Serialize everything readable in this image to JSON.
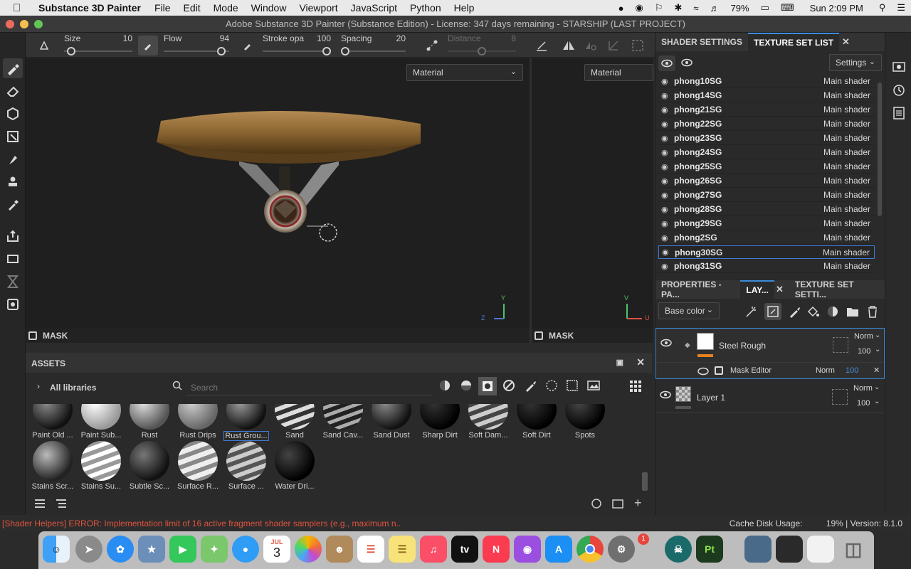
{
  "menubar": {
    "app": "Substance 3D Painter",
    "items": [
      "File",
      "Edit",
      "Mode",
      "Window",
      "Viewport",
      "JavaScript",
      "Python",
      "Help"
    ],
    "battery": "79%",
    "clock": "Sun 2:09 PM"
  },
  "window": {
    "title": "Adobe Substance 3D Painter (Substance Edition) - License: 347 days remaining - STARSHIP (LAST PROJECT)"
  },
  "tool_options": {
    "size_label": "Size",
    "size_value": "10",
    "size_fraction": 0.05,
    "flow_label": "Flow",
    "flow_value": "94",
    "flow_fraction": 0.94,
    "stroke_label": "Stroke opa",
    "stroke_value": "100",
    "stroke_fraction": 1.0,
    "spacing_label": "Spacing",
    "spacing_value": "20",
    "spacing_fraction": 0.0,
    "distance_label": "Distance",
    "distance_value": "8",
    "distance_fraction": 0.5
  },
  "viewport": {
    "channel_3d": "Material",
    "channel_2d": "Material",
    "mask_label": "MASK",
    "axis_y": "Y",
    "axis_z": "Z",
    "axis_u": "U",
    "axis_v": "V"
  },
  "assets": {
    "title": "ASSETS",
    "library": "All libraries",
    "search_placeholder": "Search",
    "row1": [
      "Paint Old ...",
      "Paint Sub...",
      "Rust",
      "Rust Drips",
      "Rust Grou...",
      "Sand",
      "Sand Cav...",
      "Sand Dust",
      "Sharp Dirt",
      "Soft Dam...",
      "Soft Dirt",
      "Spots"
    ],
    "row2": [
      "Stains Scr...",
      "Stains Su...",
      "Subtle Sc...",
      "Surface R...",
      "Surface ...",
      "Water Dri..."
    ],
    "selected": "Rust Grou..."
  },
  "texture_set": {
    "tab_shader": "SHADER SETTINGS",
    "tab_list": "TEXTURE SET LIST",
    "settings_label": "Settings",
    "rows": [
      {
        "name": "phong10SG",
        "shader": "Main shader"
      },
      {
        "name": "phong14SG",
        "shader": "Main shader"
      },
      {
        "name": "phong21SG",
        "shader": "Main shader"
      },
      {
        "name": "phong22SG",
        "shader": "Main shader"
      },
      {
        "name": "phong23SG",
        "shader": "Main shader"
      },
      {
        "name": "phong24SG",
        "shader": "Main shader"
      },
      {
        "name": "phong25SG",
        "shader": "Main shader"
      },
      {
        "name": "phong26SG",
        "shader": "Main shader"
      },
      {
        "name": "phong27SG",
        "shader": "Main shader"
      },
      {
        "name": "phong28SG",
        "shader": "Main shader"
      },
      {
        "name": "phong29SG",
        "shader": "Main shader"
      },
      {
        "name": "phong2SG",
        "shader": "Main shader"
      },
      {
        "name": "phong30SG",
        "shader": "Main shader"
      },
      {
        "name": "phong31SG",
        "shader": "Main shader"
      }
    ],
    "selected": "phong30SG"
  },
  "layers": {
    "tab_properties": "PROPERTIES - PA...",
    "tab_layers": "LAY...",
    "tab_texset": "TEXTURE SET SETTI...",
    "channel": "Base color",
    "items": [
      {
        "name": "Steel Rough",
        "blend": "Norm",
        "opacity": "100"
      },
      {
        "name": "Mask Editor",
        "blend": "Norm",
        "opacity": "100"
      },
      {
        "name": "Layer 1",
        "blend": "Norm",
        "opacity": "100"
      }
    ]
  },
  "status": {
    "error": "[Shader Helpers] ERROR: Implementation limit of 16 active fragment shader samplers (e.g., maximum n...",
    "cache": "Cache Disk Usage:",
    "cache_value": "19% | Version: 8.1.0"
  },
  "dock": {
    "calendar_month": "JUL",
    "calendar_day": "3",
    "appletv": "tv",
    "painter_label": "Pt",
    "badge": "1"
  },
  "colors": {
    "accent": "#3a8bd8",
    "error": "#e0533f",
    "orange": "#e8821e"
  }
}
